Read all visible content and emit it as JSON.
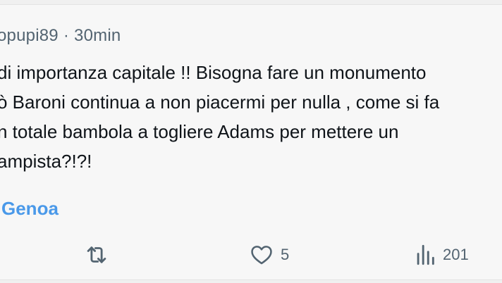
{
  "tweet": {
    "handle": "opupi89",
    "separator": "·",
    "time": "30min",
    "lines": [
      "di importanza capitale !! Bisogna fare un monumento",
      "ò Baroni continua a non piacermi per nulla , come si fa",
      "n totale bambola a togliere Adams per mettere un",
      "ampista?!?!"
    ],
    "hashtag": "Genoa"
  },
  "actions": {
    "retweet": {
      "icon": "retweet-icon",
      "count": ""
    },
    "like": {
      "icon": "heart-icon",
      "count": "5"
    },
    "views": {
      "icon": "views-chart-icon",
      "count": "201"
    }
  },
  "colors": {
    "text": "#0f1419",
    "secondary": "#536471",
    "link": "#4a99e9",
    "background": "#f7f7f7"
  }
}
